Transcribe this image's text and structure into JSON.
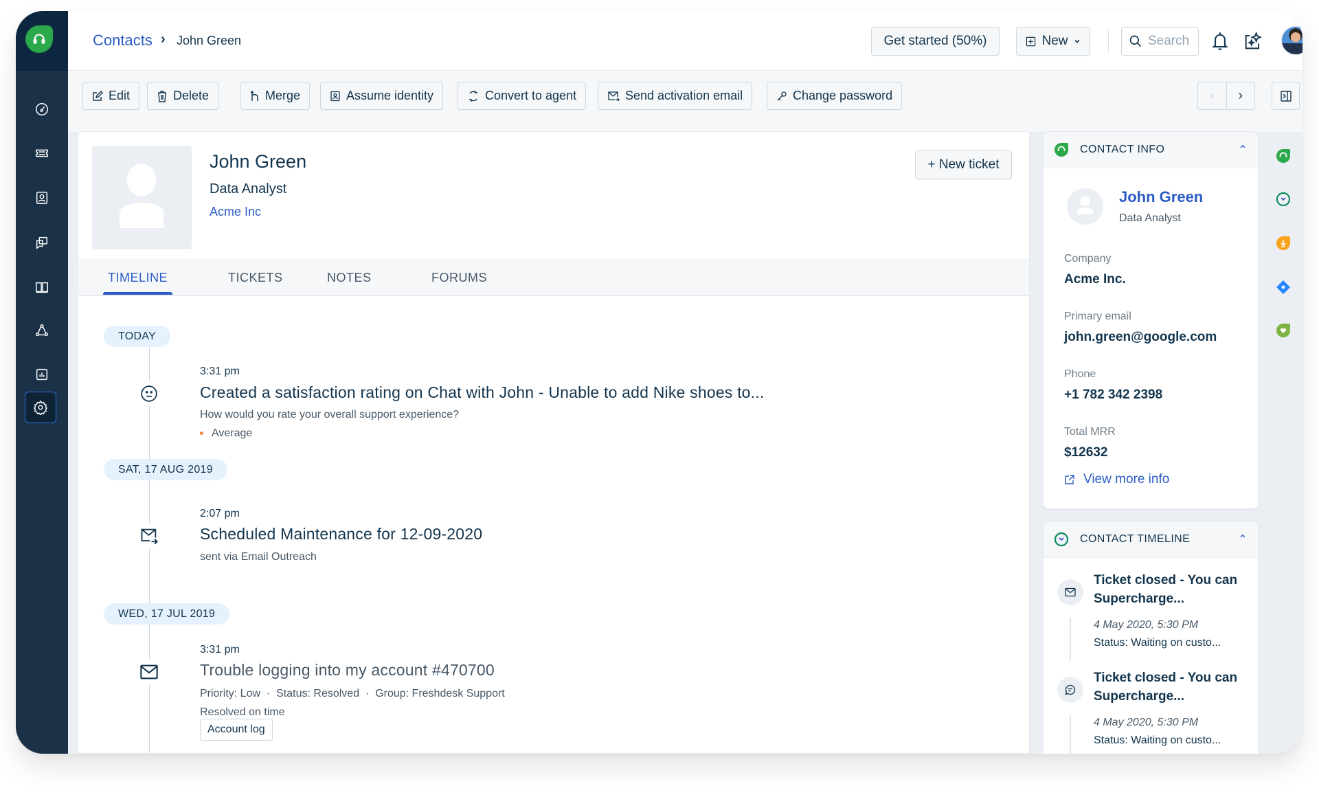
{
  "breadcrumb": {
    "parent": "Contacts",
    "separator": "›",
    "current": "John Green"
  },
  "header": {
    "get_started_label": "Get started (50%)",
    "new_label": "New",
    "search_placeholder": "Search"
  },
  "sidebar": {
    "items": [
      {
        "name": "dashboard",
        "icon": "gauge-icon"
      },
      {
        "name": "tickets",
        "icon": "ticket-icon"
      },
      {
        "name": "contacts",
        "icon": "contact-card-icon"
      },
      {
        "name": "conversations",
        "icon": "chat-bubbles-icon"
      },
      {
        "name": "knowledge-base",
        "icon": "book-icon"
      },
      {
        "name": "community",
        "icon": "network-icon"
      },
      {
        "name": "reports",
        "icon": "bar-chart-icon"
      },
      {
        "name": "admin",
        "icon": "gear-icon",
        "active": true
      }
    ]
  },
  "toolbar": {
    "buttons": [
      {
        "label": "Edit",
        "icon": "edit-icon"
      },
      {
        "label": "Delete",
        "icon": "trash-icon"
      },
      {
        "label": "Merge",
        "icon": "merge-icon"
      },
      {
        "label": "Assume identity",
        "icon": "identity-icon"
      },
      {
        "label": "Convert to agent",
        "icon": "convert-icon"
      },
      {
        "label": "Send activation email",
        "icon": "send-mail-icon"
      },
      {
        "label": "Change password",
        "icon": "key-icon"
      }
    ]
  },
  "contact": {
    "name": "John Green",
    "title": "Data Analyst",
    "company": "Acme Inc",
    "new_ticket_label": "+ New ticket"
  },
  "tabs": [
    {
      "label": "TIMELINE",
      "active": true
    },
    {
      "label": "TICKETS",
      "active": false
    },
    {
      "label": "NOTES",
      "active": false
    },
    {
      "label": "FORUMS",
      "active": false
    }
  ],
  "timeline": {
    "groups": [
      {
        "date": "TODAY",
        "events": [
          {
            "time": "3:31 pm",
            "icon": "neutral-face-icon",
            "title": "Created a satisfaction rating on Chat with John - Unable to add Nike shoes to...",
            "question": "How would you rate your overall support experience?",
            "rating": "Average"
          }
        ]
      },
      {
        "date": "SAT, 17 AUG 2019",
        "events": [
          {
            "time": "2:07 pm",
            "icon": "email-outreach-icon",
            "title": "Scheduled Maintenance for 12-09-2020",
            "subtitle": "sent via Email Outreach"
          }
        ]
      },
      {
        "date": "WED, 17 JUL 2019",
        "events": [
          {
            "time": "3:31 pm",
            "icon": "envelope-icon",
            "title": "Trouble logging into my account #470700",
            "meta": "Priority: Low  ·  Status: Resolved  ·  Group: Freshdesk Support",
            "sla": "Resolved on time",
            "button": "Account log"
          }
        ]
      }
    ]
  },
  "contact_info": {
    "heading": "CONTACT INFO",
    "name": "John Green",
    "title": "Data Analyst",
    "fields": [
      {
        "label": "Company",
        "value": "Acme Inc."
      },
      {
        "label": "Primary email",
        "value": "john.green@google.com"
      },
      {
        "label": "Phone",
        "value": "+1 782 342 2398"
      },
      {
        "label": "Total MRR",
        "value": "$12632"
      }
    ],
    "view_more": "View more info"
  },
  "contact_timeline": {
    "heading": "CONTACT TIMELINE",
    "items": [
      {
        "icon": "envelope-icon",
        "title": "Ticket closed - You can Supercharge...",
        "date": "4 May 2020, 5:30 PM",
        "status": "Status: Waiting on custo..."
      },
      {
        "icon": "chat-icon",
        "title": "Ticket closed - You can Supercharge...",
        "date": "4 May 2020, 5:30 PM",
        "status": "Status: Waiting on custo..."
      }
    ]
  },
  "app_strip": [
    {
      "name": "freshdesk-app",
      "color": "#2ba84a"
    },
    {
      "name": "timeline-app",
      "color": "#0f8a5f"
    },
    {
      "name": "orange-app",
      "color": "#f7a21b"
    },
    {
      "name": "jira-app",
      "color": "#2684ff"
    },
    {
      "name": "health-app",
      "color": "#7cb342"
    }
  ],
  "colors": {
    "brand": "#2ba84a",
    "link": "#2c5cc5",
    "sidebar": "#1b3148",
    "text": "#12344d"
  }
}
